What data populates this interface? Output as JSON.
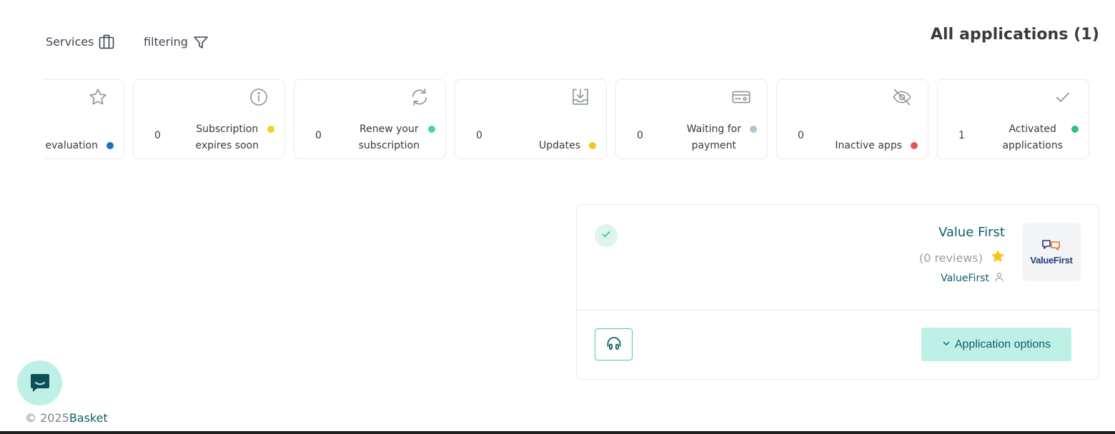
{
  "header": {
    "title": "All applications (1)",
    "services_label": "Services",
    "filtering_label": "filtering"
  },
  "status_cards": [
    {
      "label_line1": "evaluation",
      "label_line2": "",
      "count": "",
      "icon": "star-icon",
      "dot_color": "#1f6fbf"
    },
    {
      "label_line1": "Subscription",
      "label_line2": "expires soon",
      "count": "0",
      "icon": "info-icon",
      "dot_color": "#f2d024"
    },
    {
      "label_line1": "Renew your",
      "label_line2": "subscription",
      "count": "0",
      "icon": "refresh-icon",
      "dot_color": "#4dd0b6"
    },
    {
      "label_line1": "Updates",
      "label_line2": "",
      "count": "0",
      "icon": "download-tray-icon",
      "dot_color": "#f2c624"
    },
    {
      "label_line1": "Waiting for",
      "label_line2": "payment",
      "count": "0",
      "icon": "payment-card-icon",
      "dot_color": "#a9c8d3"
    },
    {
      "label_line1": "Inactive apps",
      "label_line2": "",
      "count": "0",
      "icon": "eye-off-icon",
      "dot_color": "#e95353"
    },
    {
      "label_line1": "Activated",
      "label_line2": "applications",
      "count": "1",
      "icon": "check-icon",
      "dot_color": "#2ec27e"
    }
  ],
  "app": {
    "name": "Value First",
    "reviews": "(0 reviews)",
    "vendor": "ValueFirst",
    "logo_text": "ValueFirst",
    "options_label": "Application options",
    "status_icon": "check-icon",
    "rating_icon": "star-icon",
    "vendor_icon": "user-icon",
    "support_icon": "headphones-icon"
  },
  "footer": {
    "copyright": "© 2025",
    "brand": "Basket"
  },
  "colors": {
    "accent": "#0e5f6a",
    "accent_light": "#bff0e6",
    "border": "#e6ebee",
    "star": "#f5c518"
  }
}
